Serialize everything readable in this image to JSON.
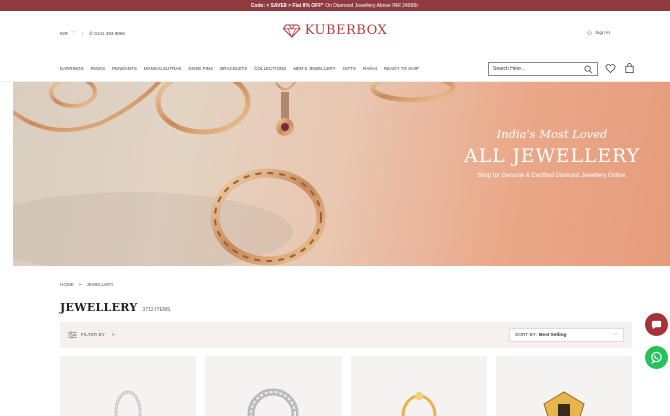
{
  "promo": {
    "code_text": "Code: < SAVE8 > Flat 8% OFF*",
    "rest_text": "On Diamond Jewellery Above INR 24999/-"
  },
  "header": {
    "currency": "INR",
    "phone": "0141 493 8866",
    "brand": "KUBERBOX",
    "sign_in": "Sign In",
    "brand_color": "#b43a40"
  },
  "nav": {
    "items": [
      "EARRINGS",
      "RINGS",
      "PENDANTS",
      "MANGALSUTRAS",
      "NOSE PINS",
      "BRACELETS",
      "COLLECTIONS",
      "MEN'S JEWELLERY",
      "GIFTS",
      "RAKHI",
      "READY TO SHIP"
    ],
    "search_placeholder": "Search Here..."
  },
  "hero": {
    "subtitle": "India's Most Loved",
    "title": "ALL JEWELLERY",
    "description": "Shop for Genuine & Certified Diamond Jewellery Online."
  },
  "breadcrumb": {
    "home": "HOME",
    "separator": ">",
    "current": "JEWELLERY"
  },
  "listing": {
    "title": "JEWELLERY",
    "count": "3712 ITEMS"
  },
  "filters": {
    "filter_label": "FILTER BY",
    "filter_chevron": ">",
    "sort_label": "SORT BY:",
    "sort_value": "Best Selling"
  },
  "products": [
    {
      "icon": "silver-hoop-earring-icon"
    },
    {
      "icon": "silver-diamond-hoop-icon"
    },
    {
      "icon": "gold-ring-icon"
    },
    {
      "icon": "gold-pendant-icon"
    }
  ],
  "floating": {
    "chat_color": "#a5323a",
    "whatsapp_color": "#25c25a"
  }
}
